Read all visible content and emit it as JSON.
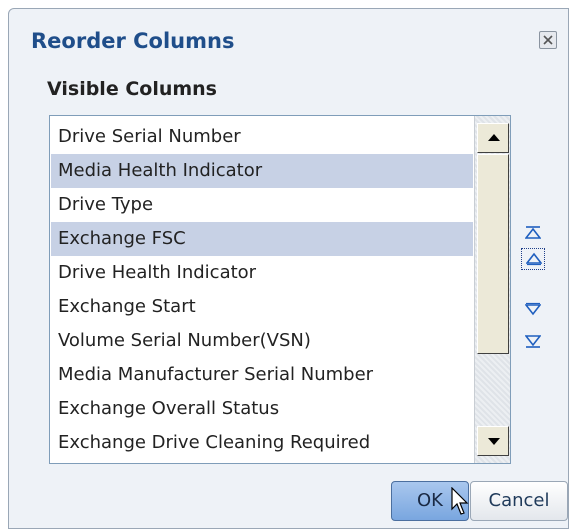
{
  "dialog": {
    "title": "Reorder Columns",
    "subtitle": "Visible Columns",
    "close_icon": "close-icon"
  },
  "columns": [
    {
      "label": "Drive Serial Number",
      "selected": false
    },
    {
      "label": "Media Health Indicator",
      "selected": true
    },
    {
      "label": "Drive Type",
      "selected": false
    },
    {
      "label": "Exchange FSC",
      "selected": true
    },
    {
      "label": "Drive Health Indicator",
      "selected": false
    },
    {
      "label": "Exchange Start",
      "selected": false
    },
    {
      "label": "Volume Serial Number(VSN)",
      "selected": false
    },
    {
      "label": "Media Manufacturer Serial Number",
      "selected": false
    },
    {
      "label": "Exchange Overall Status",
      "selected": false
    },
    {
      "label": "Exchange Drive Cleaning Required",
      "selected": false
    }
  ],
  "reorder_buttons": {
    "top_icon": "move-to-top-icon",
    "up_icon": "move-up-icon",
    "down_icon": "move-down-icon",
    "bottom_icon": "move-to-bottom-icon"
  },
  "buttons": {
    "ok": "OK",
    "cancel": "Cancel"
  },
  "colors": {
    "title": "#1f4e8a",
    "selection": "#c7d1e5",
    "reorder_arrow": "#1f5fbf",
    "ok_button": "#8fb6e8"
  }
}
